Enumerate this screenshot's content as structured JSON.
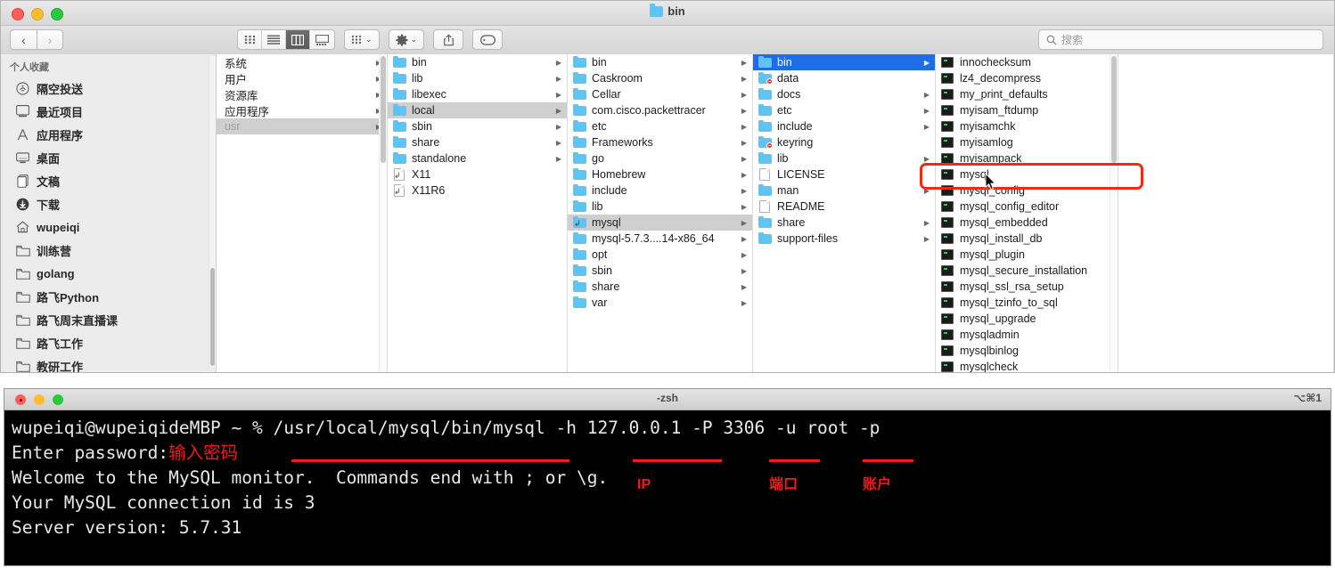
{
  "finder": {
    "window_title": "bin",
    "toolbar": {
      "back_label": "‹",
      "forward_label": "›",
      "view_icon_label": "icon-view",
      "view_list_label": "list-view",
      "view_column_label": "column-view",
      "view_gallery_label": "gallery-view",
      "group_label": "group-by",
      "action_label": "action-gear",
      "share_label": "share",
      "tag_label": "tag",
      "caret": "⌄"
    },
    "search": {
      "placeholder": "搜索",
      "value": "",
      "icon": "search-icon"
    },
    "sidebar": {
      "heading": "个人收藏",
      "items": [
        {
          "label": "隔空投送",
          "icon": "airdrop-icon"
        },
        {
          "label": "最近项目",
          "icon": "recents-icon"
        },
        {
          "label": "应用程序",
          "icon": "applications-icon"
        },
        {
          "label": "桌面",
          "icon": "desktop-icon"
        },
        {
          "label": "文稿",
          "icon": "documents-icon"
        },
        {
          "label": "下载",
          "icon": "downloads-icon"
        },
        {
          "label": "wupeiqi",
          "icon": "home-icon"
        },
        {
          "label": "训练营",
          "icon": "folder-icon"
        },
        {
          "label": "golang",
          "icon": "folder-icon"
        },
        {
          "label": "路飞Python",
          "icon": "folder-icon"
        },
        {
          "label": "路飞周末直播课",
          "icon": "folder-icon"
        },
        {
          "label": "路飞工作",
          "icon": "folder-icon"
        },
        {
          "label": "教研工作",
          "icon": "folder-icon"
        }
      ]
    },
    "columns": [
      {
        "name": "column-root",
        "has_scrollbar": true,
        "show_icons": false,
        "items": [
          {
            "label": "系统",
            "icon": "none",
            "arrow": true,
            "state": "none"
          },
          {
            "label": "用户",
            "icon": "none",
            "arrow": true,
            "state": "none"
          },
          {
            "label": "资源库",
            "icon": "none",
            "arrow": true,
            "state": "none"
          },
          {
            "label": "应用程序",
            "icon": "none",
            "arrow": true,
            "state": "none"
          },
          {
            "label": "usr",
            "icon": "none",
            "arrow": true,
            "state": "selected-inactive"
          }
        ]
      },
      {
        "name": "column-usr",
        "has_scrollbar": false,
        "show_icons": true,
        "items": [
          {
            "label": "bin",
            "icon": "folder",
            "arrow": true,
            "state": "none"
          },
          {
            "label": "lib",
            "icon": "folder",
            "arrow": true,
            "state": "none"
          },
          {
            "label": "libexec",
            "icon": "folder",
            "arrow": true,
            "state": "none"
          },
          {
            "label": "local",
            "icon": "folder",
            "arrow": true,
            "state": "selected-inactive"
          },
          {
            "label": "sbin",
            "icon": "folder",
            "arrow": true,
            "state": "none"
          },
          {
            "label": "share",
            "icon": "folder",
            "arrow": true,
            "state": "none"
          },
          {
            "label": "standalone",
            "icon": "folder",
            "arrow": true,
            "state": "none"
          },
          {
            "label": "X11",
            "icon": "alias-doc",
            "arrow": false,
            "state": "none"
          },
          {
            "label": "X11R6",
            "icon": "alias-doc",
            "arrow": false,
            "state": "none"
          }
        ]
      },
      {
        "name": "column-usr-local",
        "has_scrollbar": false,
        "show_icons": true,
        "items": [
          {
            "label": "bin",
            "icon": "folder",
            "arrow": true,
            "state": "none"
          },
          {
            "label": "Caskroom",
            "icon": "folder",
            "arrow": true,
            "state": "none"
          },
          {
            "label": "Cellar",
            "icon": "folder",
            "arrow": true,
            "state": "none"
          },
          {
            "label": "com.cisco.packettracer",
            "icon": "folder",
            "arrow": true,
            "state": "none"
          },
          {
            "label": "etc",
            "icon": "folder",
            "arrow": true,
            "state": "none"
          },
          {
            "label": "Frameworks",
            "icon": "folder",
            "arrow": true,
            "state": "none"
          },
          {
            "label": "go",
            "icon": "folder",
            "arrow": true,
            "state": "none"
          },
          {
            "label": "Homebrew",
            "icon": "folder",
            "arrow": true,
            "state": "none"
          },
          {
            "label": "include",
            "icon": "folder",
            "arrow": true,
            "state": "none"
          },
          {
            "label": "lib",
            "icon": "folder",
            "arrow": true,
            "state": "none"
          },
          {
            "label": "mysql",
            "icon": "alias-folder",
            "arrow": true,
            "state": "selected-inactive"
          },
          {
            "label": "mysql-5.7.3....14-x86_64",
            "icon": "folder",
            "arrow": true,
            "state": "none"
          },
          {
            "label": "opt",
            "icon": "folder",
            "arrow": true,
            "state": "none"
          },
          {
            "label": "sbin",
            "icon": "folder",
            "arrow": true,
            "state": "none"
          },
          {
            "label": "share",
            "icon": "folder",
            "arrow": true,
            "state": "none"
          },
          {
            "label": "var",
            "icon": "folder",
            "arrow": true,
            "state": "none"
          }
        ]
      },
      {
        "name": "column-mysql",
        "has_scrollbar": false,
        "show_icons": true,
        "items": [
          {
            "label": "bin",
            "icon": "folder",
            "arrow": true,
            "state": "selected-active"
          },
          {
            "label": "data",
            "icon": "folder-noaccess",
            "arrow": false,
            "state": "none"
          },
          {
            "label": "docs",
            "icon": "folder",
            "arrow": true,
            "state": "none"
          },
          {
            "label": "etc",
            "icon": "folder",
            "arrow": true,
            "state": "none"
          },
          {
            "label": "include",
            "icon": "folder",
            "arrow": true,
            "state": "none"
          },
          {
            "label": "keyring",
            "icon": "folder-noaccess",
            "arrow": false,
            "state": "none"
          },
          {
            "label": "lib",
            "icon": "folder",
            "arrow": true,
            "state": "none"
          },
          {
            "label": "LICENSE",
            "icon": "doc",
            "arrow": false,
            "state": "none"
          },
          {
            "label": "man",
            "icon": "folder",
            "arrow": true,
            "state": "none"
          },
          {
            "label": "README",
            "icon": "doc",
            "arrow": false,
            "state": "none"
          },
          {
            "label": "share",
            "icon": "folder",
            "arrow": true,
            "state": "none"
          },
          {
            "label": "support-files",
            "icon": "folder",
            "arrow": true,
            "state": "none"
          }
        ]
      },
      {
        "name": "column-mysql-bin",
        "has_scrollbar": true,
        "show_icons": true,
        "items": [
          {
            "label": "innochecksum",
            "icon": "executable",
            "arrow": false,
            "state": "none"
          },
          {
            "label": "lz4_decompress",
            "icon": "executable",
            "arrow": false,
            "state": "none"
          },
          {
            "label": "my_print_defaults",
            "icon": "executable",
            "arrow": false,
            "state": "none"
          },
          {
            "label": "myisam_ftdump",
            "icon": "executable",
            "arrow": false,
            "state": "none"
          },
          {
            "label": "myisamchk",
            "icon": "executable",
            "arrow": false,
            "state": "none"
          },
          {
            "label": "myisamlog",
            "icon": "executable",
            "arrow": false,
            "state": "none"
          },
          {
            "label": "myisampack",
            "icon": "executable",
            "arrow": false,
            "state": "none"
          },
          {
            "label": "mysql",
            "icon": "executable",
            "arrow": false,
            "state": "highlighted"
          },
          {
            "label": "mysql_config",
            "icon": "executable",
            "arrow": false,
            "state": "none"
          },
          {
            "label": "mysql_config_editor",
            "icon": "executable",
            "arrow": false,
            "state": "none"
          },
          {
            "label": "mysql_embedded",
            "icon": "executable",
            "arrow": false,
            "state": "none"
          },
          {
            "label": "mysql_install_db",
            "icon": "executable",
            "arrow": false,
            "state": "none"
          },
          {
            "label": "mysql_plugin",
            "icon": "executable",
            "arrow": false,
            "state": "none"
          },
          {
            "label": "mysql_secure_installation",
            "icon": "executable",
            "arrow": false,
            "state": "none"
          },
          {
            "label": "mysql_ssl_rsa_setup",
            "icon": "executable",
            "arrow": false,
            "state": "none"
          },
          {
            "label": "mysql_tzinfo_to_sql",
            "icon": "executable",
            "arrow": false,
            "state": "none"
          },
          {
            "label": "mysql_upgrade",
            "icon": "executable",
            "arrow": false,
            "state": "none"
          },
          {
            "label": "mysqladmin",
            "icon": "executable",
            "arrow": false,
            "state": "none"
          },
          {
            "label": "mysqlbinlog",
            "icon": "executable",
            "arrow": false,
            "state": "none"
          },
          {
            "label": "mysqlcheck",
            "icon": "executable",
            "arrow": false,
            "state": "none"
          }
        ]
      },
      {
        "name": "column-preview",
        "has_scrollbar": false,
        "show_icons": false,
        "items": []
      }
    ],
    "highlight_color": "#ee2b18"
  },
  "terminal": {
    "title": "-zsh",
    "shortcut_badge": "⌥⌘1",
    "lines": [
      {
        "prefix": "wupeiqi@wupeiqideMBP ~ % /usr/local/mysql/bin/mysql -h 127.0.0.1 -P 3306 -u root -p",
        "annotation": ""
      },
      {
        "prefix": "Enter password:",
        "annotation": "输入密码"
      },
      {
        "prefix": "Welcome to the MySQL monitor.  Commands end with ; or \\g.",
        "annotation": ""
      },
      {
        "prefix": "Your MySQL connection id is 3",
        "annotation": ""
      },
      {
        "prefix": "Server version: 5.7.31",
        "annotation": ""
      }
    ],
    "annotations": [
      {
        "label": "IP",
        "name": "annotation-ip"
      },
      {
        "label": "端口",
        "name": "annotation-port"
      },
      {
        "label": "账户",
        "name": "annotation-account"
      }
    ]
  }
}
